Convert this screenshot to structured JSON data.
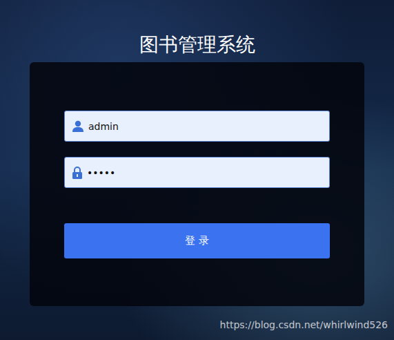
{
  "window": {
    "title": "图书管理系统"
  },
  "fields": [
    {
      "kind": "user",
      "value": "admin"
    },
    {
      "kind": "password",
      "value": "•••••"
    }
  ],
  "button": {
    "label": "登 录"
  },
  "watermark": "https://blog.csdn.net/whirlwind526"
}
